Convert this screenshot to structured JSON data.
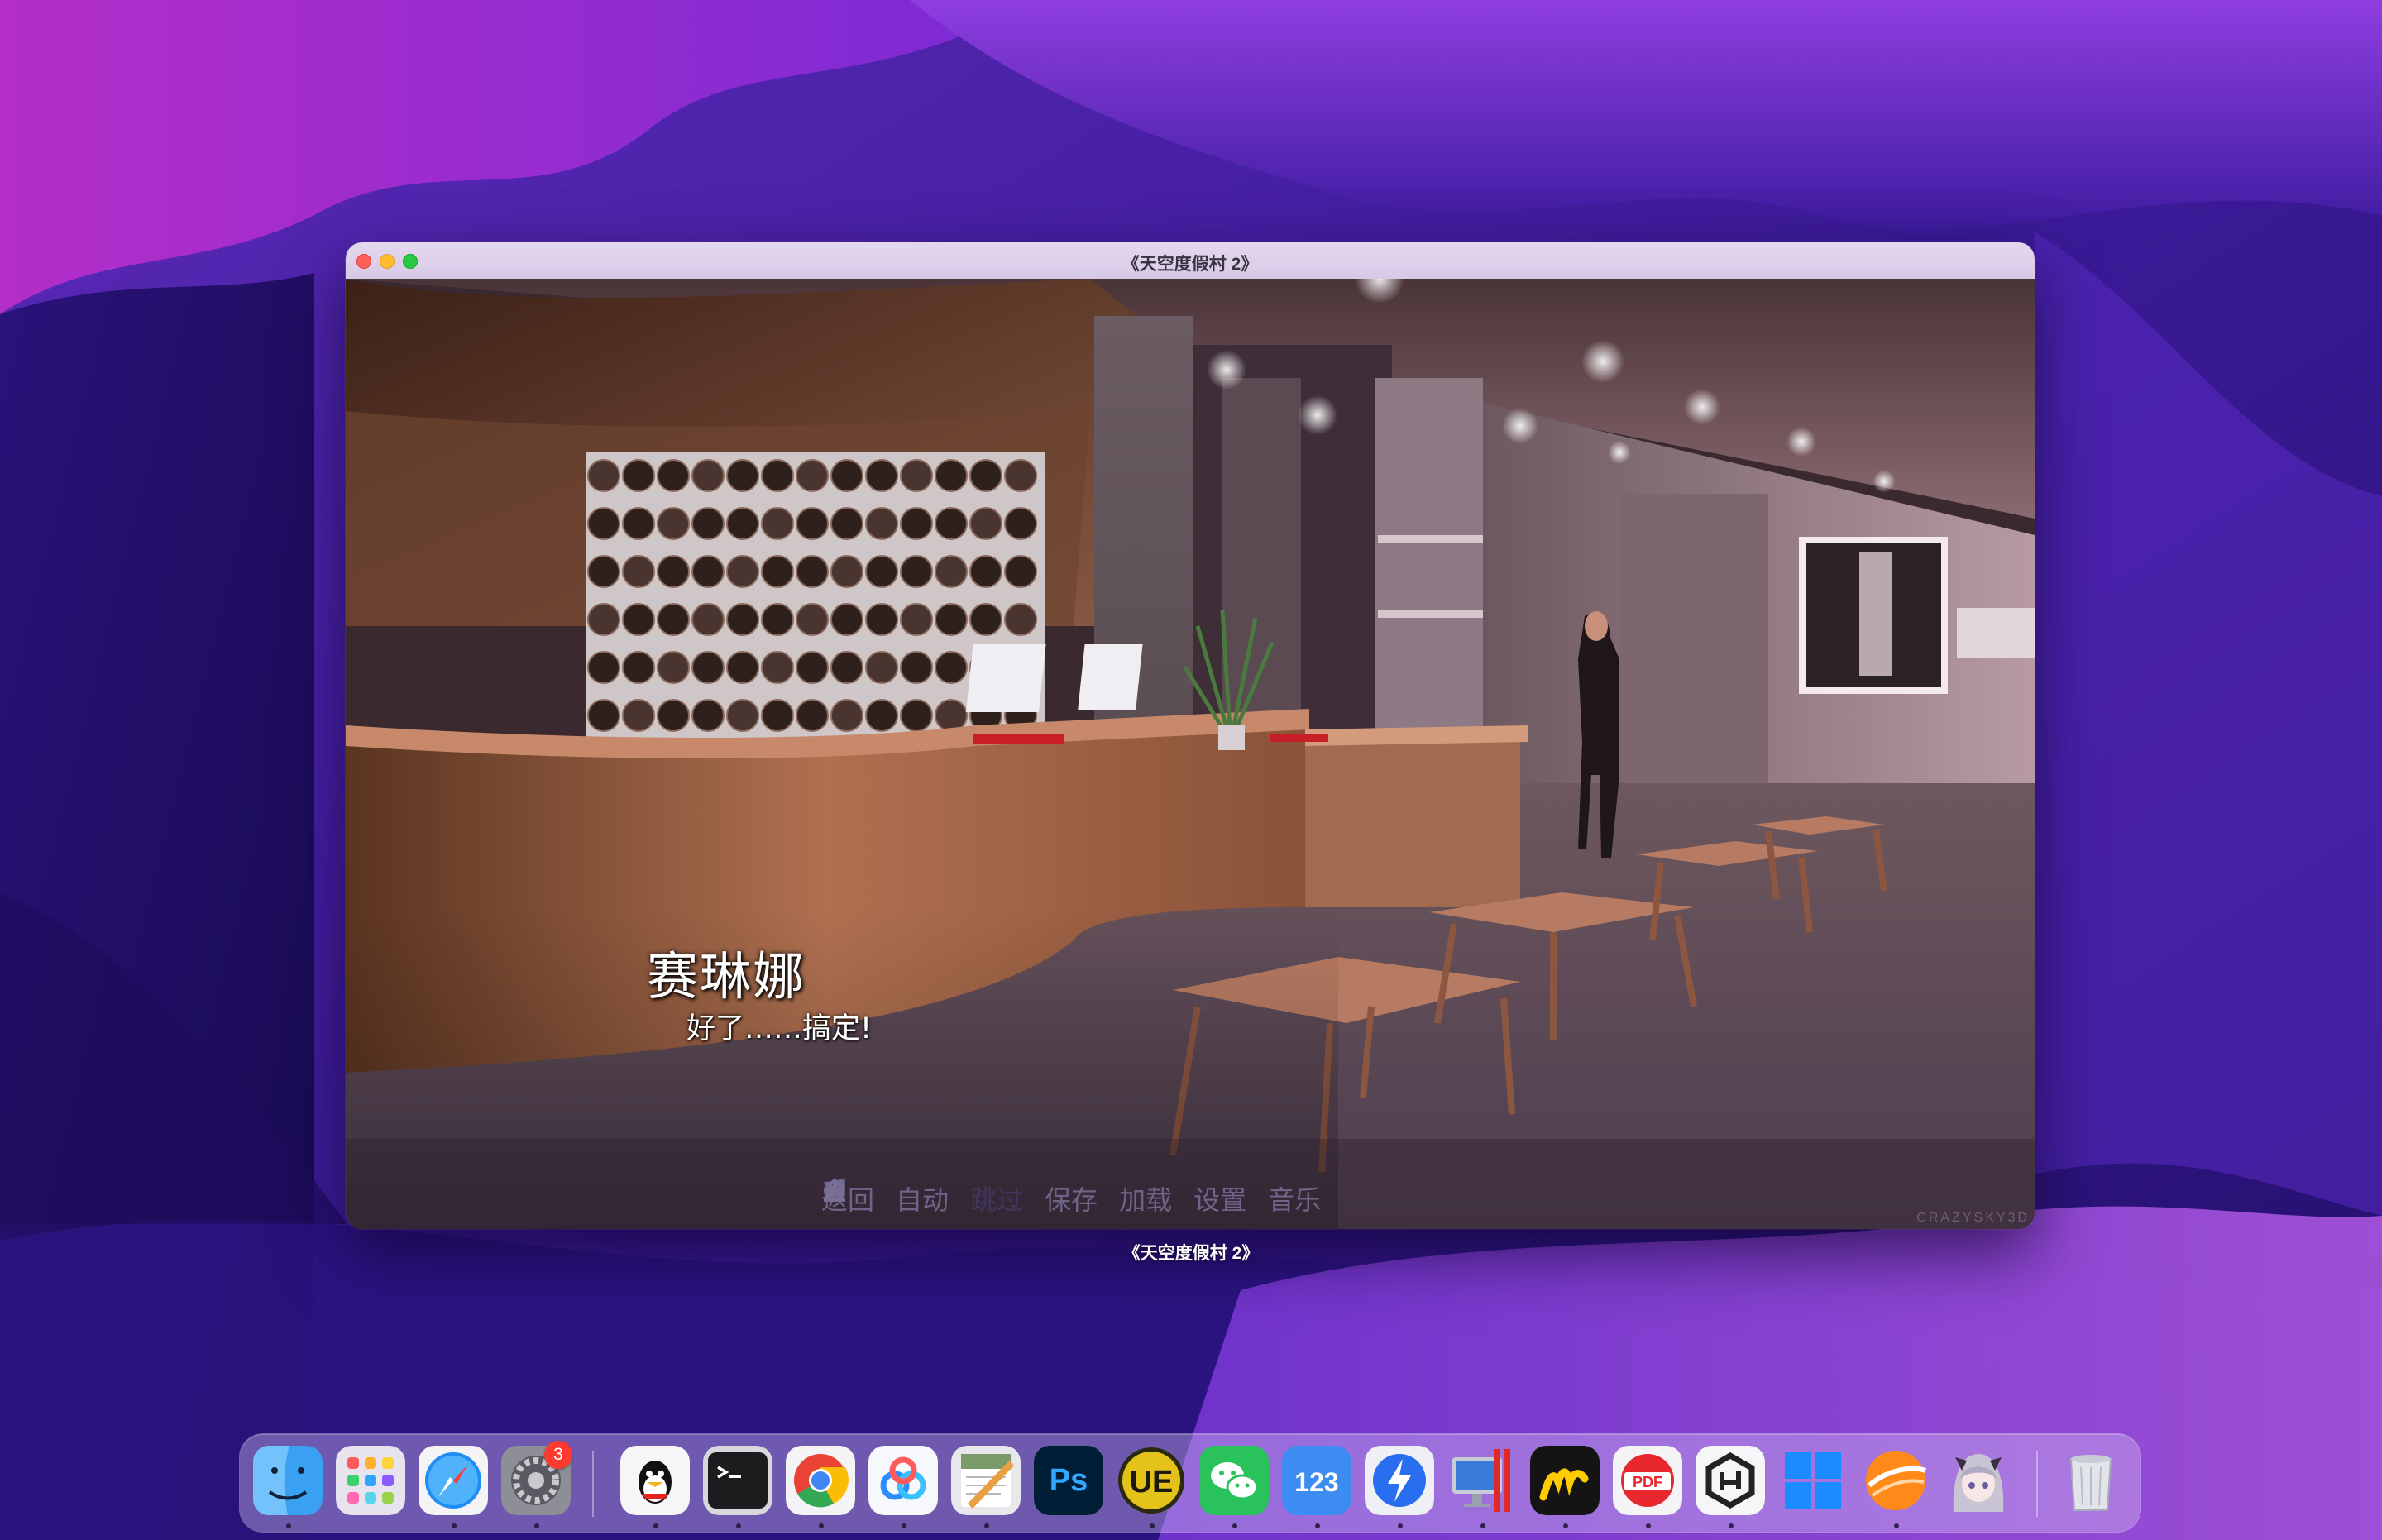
{
  "window": {
    "title": "《天空度假村 2》",
    "caption": "《天空度假村 2》"
  },
  "game": {
    "speaker": "赛琳娜",
    "dialogue": "好了……搞定!",
    "watermark": "CRAZYSKY3D",
    "quick_menu": [
      {
        "label": "返回",
        "icon": "rewind-icon"
      },
      {
        "label": "自动",
        "icon": "auto-icon"
      },
      {
        "label": "跳过",
        "icon": "skip-icon"
      },
      {
        "label": "保存",
        "icon": "save-icon"
      },
      {
        "label": "加载",
        "icon": "load-icon"
      },
      {
        "label": "设置",
        "icon": "settings-icon"
      },
      {
        "label": "音乐",
        "icon": "music-icon"
      }
    ]
  },
  "dock": {
    "apps": [
      {
        "name": "Finder",
        "icon": "finder-icon"
      },
      {
        "name": "Launchpad",
        "icon": "launchpad-icon"
      },
      {
        "name": "Safari",
        "icon": "safari-icon"
      },
      {
        "name": "System Settings",
        "icon": "system-settings-icon",
        "badge": "3"
      },
      {
        "name": "QQ",
        "icon": "qq-icon"
      },
      {
        "name": "Terminal",
        "icon": "terminal-icon"
      },
      {
        "name": "Google Chrome",
        "icon": "chrome-icon"
      },
      {
        "name": "Baidu Netdisk",
        "icon": "baidu-netdisk-icon"
      },
      {
        "name": "Script Editor",
        "icon": "script-editor-icon"
      },
      {
        "name": "Photoshop",
        "icon": "photoshop-icon",
        "text": "Ps"
      },
      {
        "name": "UltraEdit",
        "icon": "ultraedit-icon",
        "text": "UE"
      },
      {
        "name": "WeChat",
        "icon": "wechat-icon"
      },
      {
        "name": "123 Pan",
        "icon": "pan123-icon",
        "text": "123"
      },
      {
        "name": "Transmit",
        "icon": "lightning-icon"
      },
      {
        "name": "Parallels Desktop",
        "icon": "parallels-icon"
      },
      {
        "name": "Marker",
        "icon": "marker-icon"
      },
      {
        "name": "PDF Expert",
        "icon": "pdf-icon",
        "text": "PDF"
      },
      {
        "name": "App",
        "icon": "hex-icon"
      },
      {
        "name": "Windows",
        "icon": "windows-icon"
      },
      {
        "name": "Browser",
        "icon": "orange-ball-icon"
      },
      {
        "name": "Avatar App",
        "icon": "anime-avatar-icon"
      },
      {
        "name": "Trash",
        "icon": "trash-icon"
      }
    ]
  },
  "colors": {
    "wallpaper_base": "#3a1890",
    "accent": "#ff3b30"
  }
}
